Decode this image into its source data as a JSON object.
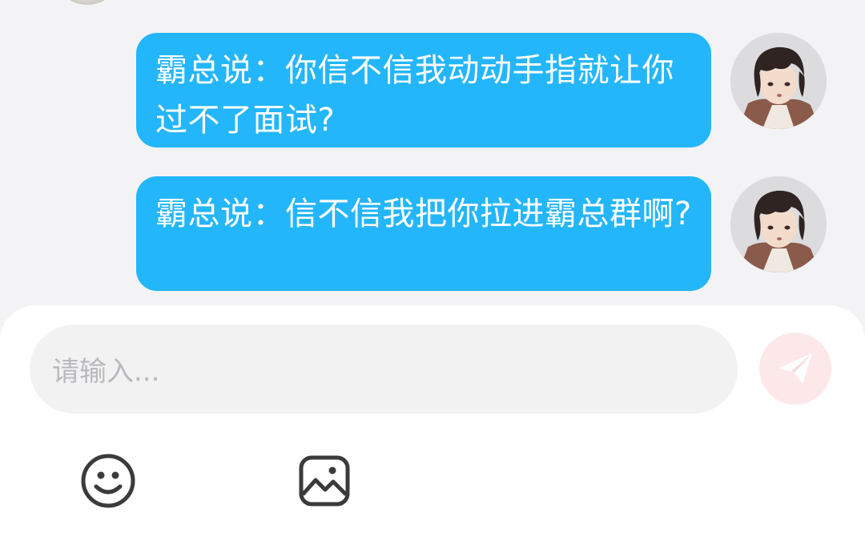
{
  "messages": [
    {
      "sender": "self",
      "text": "霸总说：你信不信我动动手指就让你过不了面试?",
      "avatar": "user-avatar"
    },
    {
      "sender": "self",
      "text": "霸总说：信不信我把你拉进霸总群啊?",
      "avatar": "user-avatar"
    }
  ],
  "composer": {
    "placeholder": "请输入...",
    "send_icon": "send-icon",
    "tools": [
      {
        "icon": "emoji-icon"
      },
      {
        "icon": "image-icon"
      }
    ]
  },
  "colors": {
    "bubble": "#24b6fb",
    "background": "#f3f3f5",
    "send_button": "#fde8e9",
    "send_icon": "#ffffff"
  }
}
